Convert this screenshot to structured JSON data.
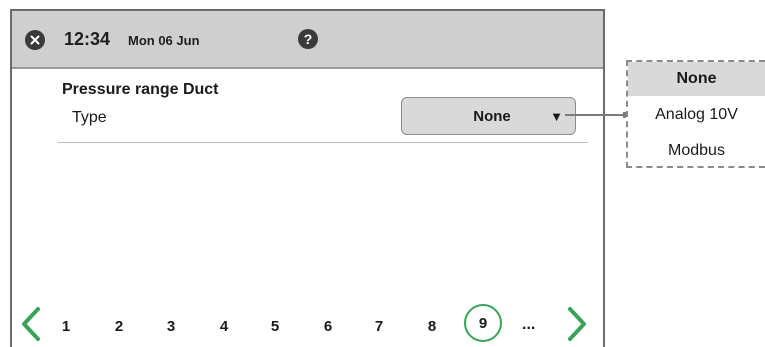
{
  "header": {
    "time": "12:34",
    "date": "Mon 06 Jun",
    "help_label": "?"
  },
  "main": {
    "section_title": "Pressure range Duct",
    "row_label": "Type",
    "select_value": "None",
    "select_arrow": "▼"
  },
  "pager": {
    "pages": [
      "1",
      "2",
      "3",
      "4",
      "5",
      "6",
      "7",
      "8"
    ],
    "current": "9",
    "more": "..."
  },
  "dropdown": {
    "options": [
      "None",
      "Analog 10V",
      "Modbus"
    ],
    "selected": "None"
  },
  "colors": {
    "accent": "#3aa35a",
    "topbar": "#cfcfcf",
    "select_bg": "#d9d9d9"
  }
}
